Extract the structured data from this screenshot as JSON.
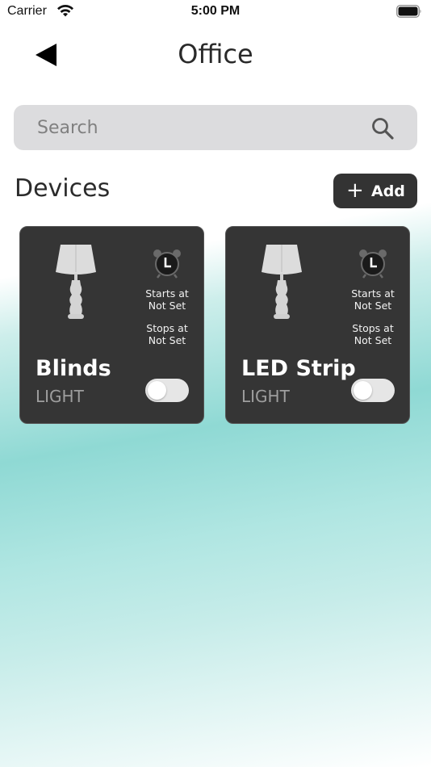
{
  "status_bar": {
    "carrier": "Carrier",
    "time": "5:00 PM",
    "wifi_icon": "wifi-icon",
    "battery_icon": "battery-icon"
  },
  "header": {
    "back_icon": "back-triangle-icon",
    "title": "Office"
  },
  "search": {
    "placeholder": "Search",
    "icon": "search-icon"
  },
  "devices_section": {
    "title": "Devices",
    "add_label": "Add",
    "add_icon": "plus-icon"
  },
  "devices": [
    {
      "name": "Blinds",
      "type": "LIGHT",
      "starts_label": "Starts at",
      "starts_value": "Not Set",
      "stops_label": "Stops at",
      "stops_value": "Not Set",
      "enabled": false
    },
    {
      "name": "LED Strip",
      "type": "LIGHT",
      "starts_label": "Starts at",
      "starts_value": "Not Set",
      "stops_label": "Stops at",
      "stops_value": "Not Set",
      "enabled": false
    }
  ],
  "colors": {
    "card_background": "#353535",
    "toggle_off": "#e6e6e6",
    "accent_teal": "#8fd9d4"
  }
}
